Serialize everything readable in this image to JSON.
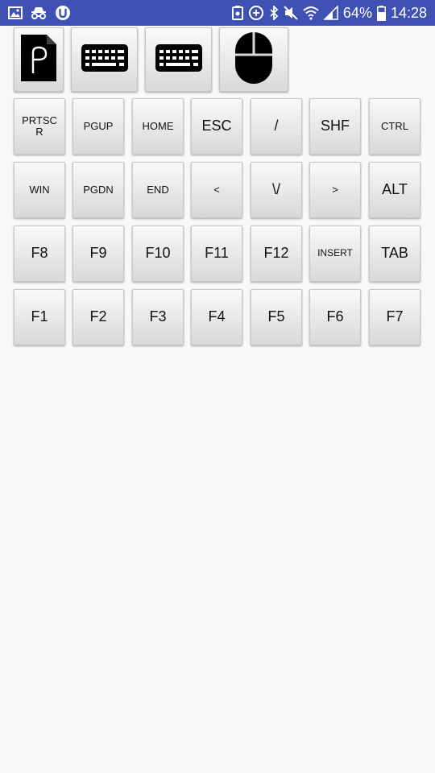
{
  "status_bar": {
    "battery_percent": "64%",
    "time": "14:28",
    "left_icons": [
      "gallery-icon",
      "spy-icon",
      "u-badge-icon"
    ],
    "right_icons": [
      "storage-icon",
      "data-saver-icon",
      "bluetooth-icon",
      "mute-icon",
      "wifi-icon",
      "signal-icon",
      "battery-icon"
    ]
  },
  "toolbar": {
    "buttons": [
      {
        "name": "document-button",
        "icon": "document-p-icon"
      },
      {
        "name": "keyboard-button-1",
        "icon": "keyboard-icon"
      },
      {
        "name": "keyboard-button-2",
        "icon": "keyboard-icon"
      },
      {
        "name": "mouse-button",
        "icon": "mouse-icon"
      }
    ]
  },
  "keys": {
    "row1": [
      "PRTSCR",
      "PGUP",
      "HOME",
      "ESC",
      "/",
      "SHF",
      "CTRL"
    ],
    "row2": [
      "WIN",
      "PGDN",
      "END",
      "<",
      "\\/",
      ">",
      "ALT"
    ],
    "row3": [
      "F8",
      "F9",
      "F10",
      "F11",
      "F12",
      "INSERT",
      "TAB"
    ],
    "row4": [
      "F1",
      "F2",
      "F3",
      "F4",
      "F5",
      "F6",
      "F7"
    ]
  },
  "colors": {
    "status_bar": "#3f51b5",
    "background": "#f8f8f8",
    "key_face": "#e6e6e6",
    "key_text": "#111111"
  }
}
